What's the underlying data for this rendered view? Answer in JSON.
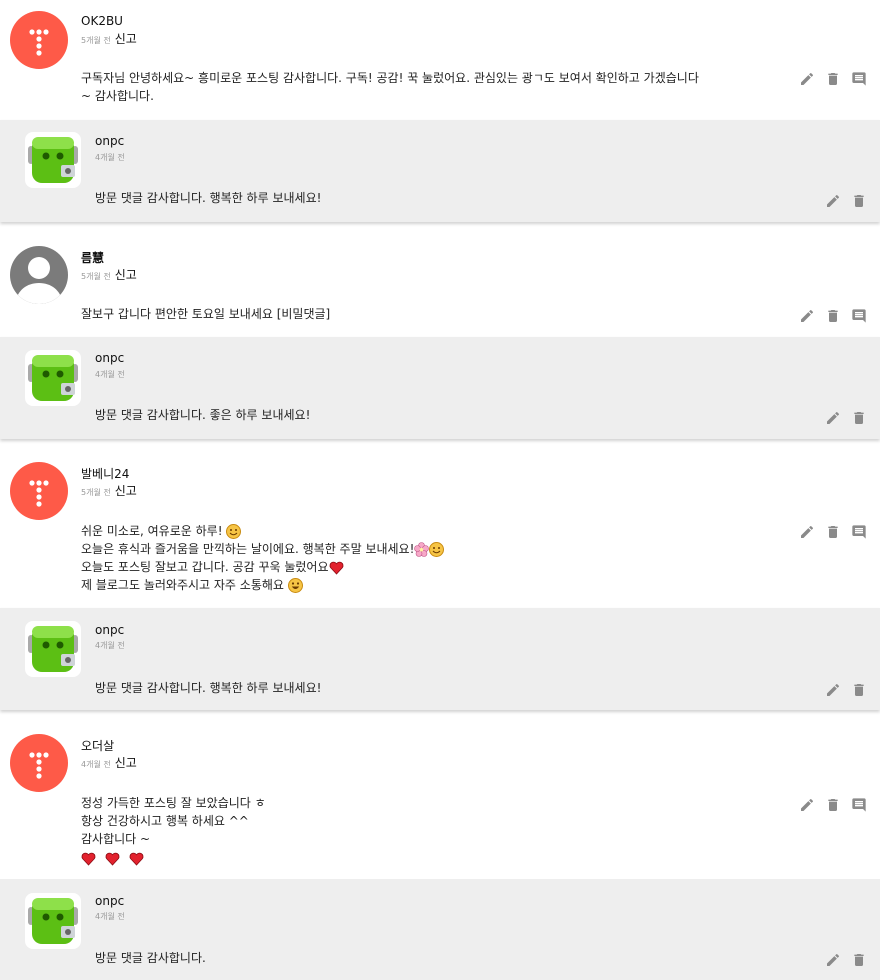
{
  "comments": [
    {
      "name": "OK2BU",
      "time": "5개월 전",
      "report": "신고",
      "lines": [
        "구독자님 안녕하세요~ 흥미로운 포스팅 감사합니다. 구독! 공감! 꾹 눌렀어요. 관심있는 광ㄱ도 보여서 확인하고 가겠습니다",
        "~ 감사합니다."
      ],
      "reply": {
        "name": "onpc",
        "time": "4개월 전",
        "text": "방문 댓글 감사합니다. 행복한 하루 보내세요!"
      }
    },
    {
      "name": "름慧",
      "time": "5개월 전",
      "report": "신고",
      "lines": [
        "잘보구 갑니다 편안한 토요일 보내세요 [비밀댓글]"
      ],
      "reply": {
        "name": "onpc",
        "time": "4개월 전",
        "text": "방문 댓글 감사합니다. 좋은 하루 보내세요!"
      }
    },
    {
      "name": "발베니24",
      "time": "5개월 전",
      "report": "신고",
      "lines": [
        "쉬운 미소로, 여유로운 하루!",
        "오늘은 휴식과 즐거움을 만끽하는 날이에요. 행복한 주말 보내세요!",
        "오늘도 포스팅 잘보고 갑니다. 공감 꾸욱 눌렀어요",
        "제 블로그도 놀러와주시고 자주 소통해요"
      ],
      "reply": {
        "name": "onpc",
        "time": "4개월 전",
        "text": "방문 댓글 감사합니다. 행복한 하루 보내세요!"
      }
    },
    {
      "name": "오더살",
      "time": "4개월 전",
      "report": "신고",
      "lines": [
        "정성 가득한 포스팅 잘 보았습니다 ㅎ",
        "항상 건강하시고 행복 하세요 ^^",
        "감사합니다 ~"
      ],
      "reply": {
        "name": "onpc",
        "time": "4개월 전",
        "text": "방문 댓글 감사합니다."
      }
    }
  ],
  "icons": {
    "edit": "pencil-icon",
    "delete": "trash-icon",
    "reply": "comment-icon"
  },
  "colors": {
    "tistory_avatar": "#fe5a48",
    "reply_bg": "#eeeeee",
    "icon": "#8a8a8a"
  }
}
